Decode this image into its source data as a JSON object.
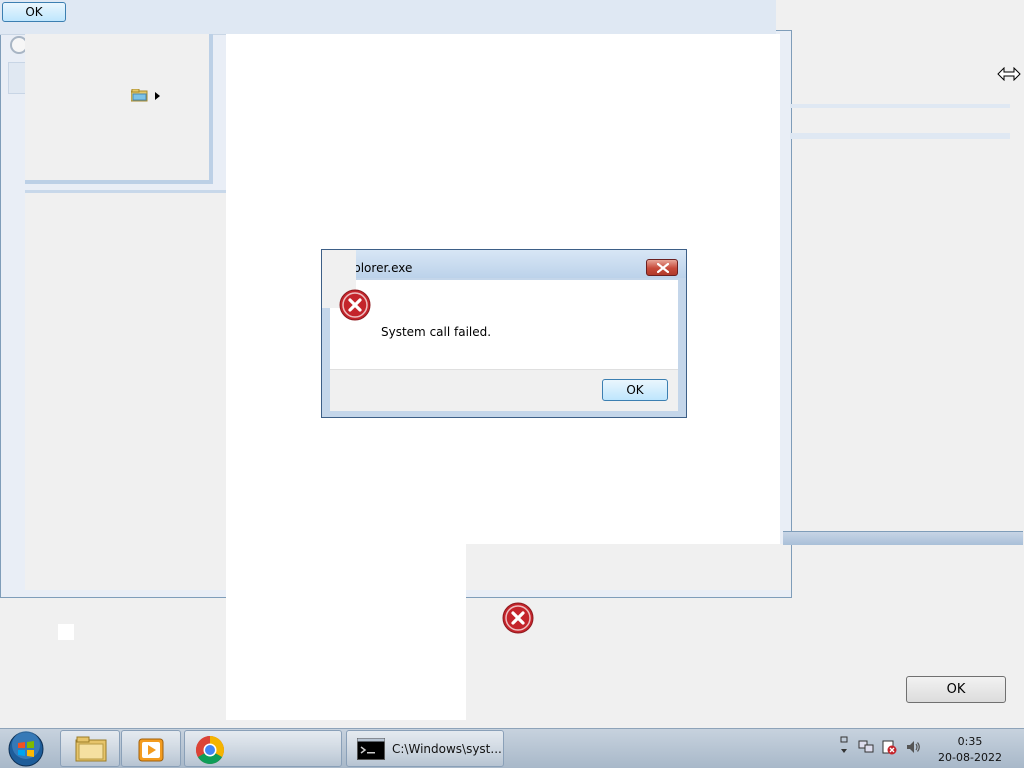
{
  "top_button": {
    "label": "OK"
  },
  "bottom_button": {
    "label": "OK"
  },
  "dialog": {
    "title": "xplorer.exe",
    "message": "System call failed.",
    "ok_label": "OK"
  },
  "taskbar": {
    "items": [
      {
        "name": "explorer",
        "label": ""
      },
      {
        "name": "media",
        "label": ""
      },
      {
        "name": "chrome",
        "label": ""
      },
      {
        "name": "cmd",
        "label": "C:\\Windows\\syst..."
      }
    ],
    "clock": {
      "time": "0:35",
      "date": "20-08-2022"
    }
  },
  "colors": {
    "error_red": "#c4242b",
    "titlebar": "#bcd2ea",
    "taskbar": "#b6c4d4"
  }
}
